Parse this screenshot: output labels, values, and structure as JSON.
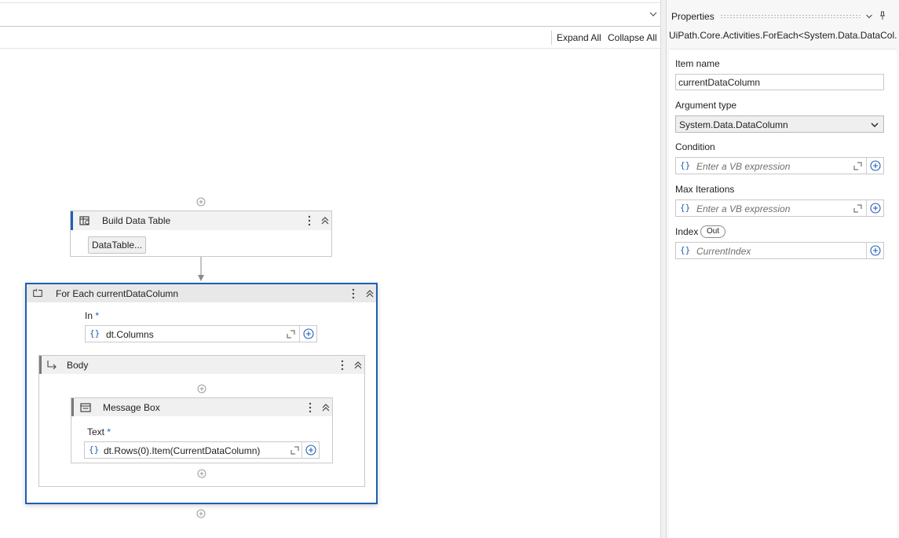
{
  "toolbar": {
    "expand_all": "Expand All",
    "collapse_all": "Collapse All"
  },
  "workflow": {
    "build_data_table": {
      "title": "Build Data Table",
      "button": "DataTable..."
    },
    "foreach": {
      "title": "For Each currentDataColumn",
      "in_label": "In",
      "required_mark": "*",
      "in_value": "dt.Columns",
      "body": {
        "title": "Body",
        "message_box": {
          "title": "Message Box",
          "text_label": "Text",
          "required_mark": "*",
          "text_value": "dt.Rows(0).Item(CurrentDataColumn)"
        }
      }
    },
    "braces": "{}"
  },
  "properties": {
    "title": "Properties",
    "type_name": "UiPath.Core.Activities.ForEach<System.Data.DataCol...",
    "item_name_label": "Item name",
    "item_name_value": "currentDataColumn",
    "argument_type_label": "Argument type",
    "argument_type_value": "System.Data.DataColumn",
    "condition_label": "Condition",
    "condition_placeholder": "Enter a VB expression",
    "max_iterations_label": "Max Iterations",
    "max_iterations_placeholder": "Enter a VB expression",
    "index_label": "Index",
    "index_badge": "Out",
    "index_placeholder": "CurrentIndex",
    "braces": "{}"
  },
  "colors": {
    "accent": "#1f5fb8",
    "selected_border": "#1d5fb4"
  }
}
